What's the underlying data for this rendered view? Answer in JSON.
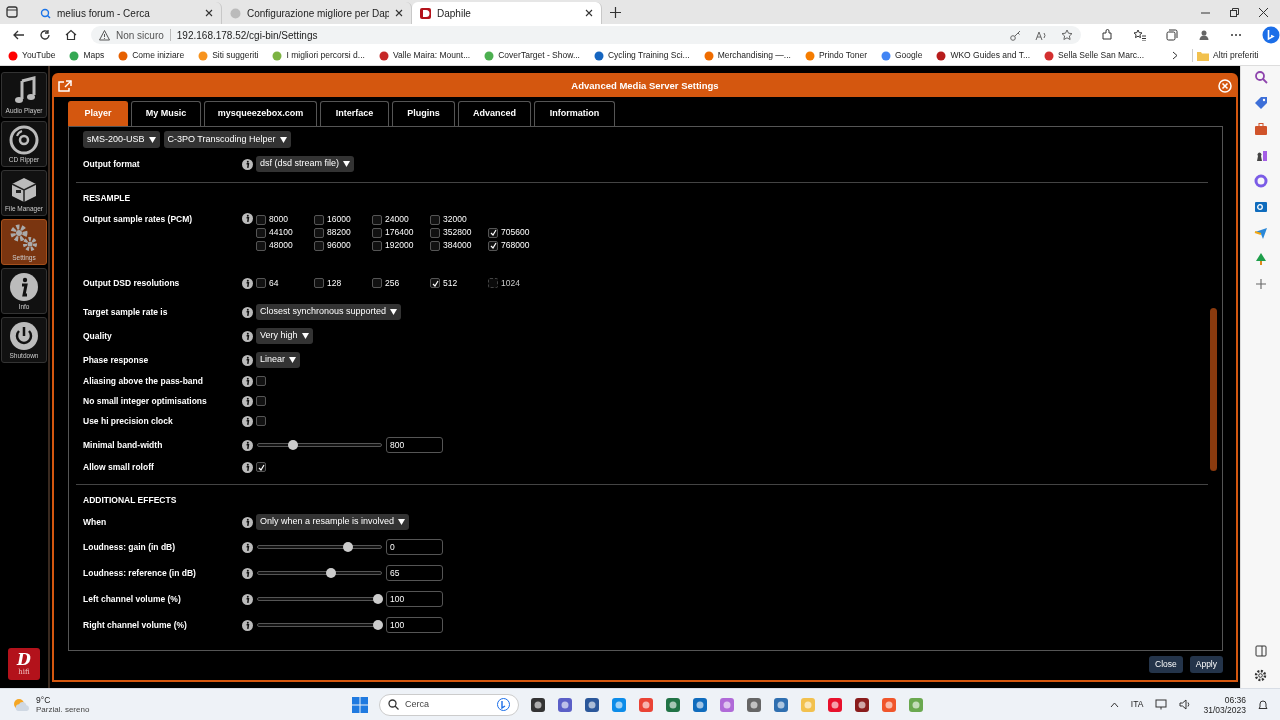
{
  "browser": {
    "tabs": [
      {
        "title": "melius forum - Cerca",
        "kind": "search",
        "selected": false
      },
      {
        "title": "Configurazione migliore per Dap",
        "kind": "page",
        "selected": false
      },
      {
        "title": "Daphile",
        "kind": "site",
        "selected": true
      }
    ],
    "security": "Non sicuro",
    "url": "192.168.178.52/cgi-bin/Settings",
    "bookmarks": [
      {
        "label": "YouTube",
        "color": "#ff0000"
      },
      {
        "label": "Maps",
        "color": "#34a853"
      },
      {
        "label": "Come iniziare",
        "color": "#e66000"
      },
      {
        "label": "Siti suggeriti",
        "color": "#f7931e"
      },
      {
        "label": "I migliori percorsi d...",
        "color": "#7cb342"
      },
      {
        "label": "Valle Maira: Mount...",
        "color": "#c62828"
      },
      {
        "label": "CoverTarget - Show...",
        "color": "#4caf50"
      },
      {
        "label": "Cycling Training Sci...",
        "color": "#1565c0"
      },
      {
        "label": "Merchandising —...",
        "color": "#ef6c00"
      },
      {
        "label": "Prindo Toner",
        "color": "#f57c00"
      },
      {
        "label": "Google",
        "color": "#4285f4"
      },
      {
        "label": "WKO Guides and T...",
        "color": "#b71c1c"
      },
      {
        "label": "Sella Selle San Marc...",
        "color": "#d32f2f"
      }
    ],
    "other_bookmarks": "Altri preferiti"
  },
  "sidebar": {
    "items": [
      {
        "label": "Audio Player",
        "kind": "music",
        "selected": false
      },
      {
        "label": "CD Ripper",
        "kind": "disc",
        "selected": false
      },
      {
        "label": "File Manager",
        "kind": "box",
        "selected": false
      },
      {
        "label": "Settings",
        "kind": "gears",
        "selected": true
      },
      {
        "label": "Info",
        "kind": "info",
        "selected": false
      },
      {
        "label": "Shutdown",
        "kind": "power",
        "selected": false
      }
    ],
    "logo": {
      "letter": "D",
      "caption": "hifi"
    }
  },
  "dialog": {
    "title": "Advanced Media Server Settings",
    "tabs": [
      {
        "label": "Player",
        "selected": true
      },
      {
        "label": "My Music",
        "selected": false
      },
      {
        "label": "mysqueezebox.com",
        "selected": false
      },
      {
        "label": "Interface",
        "selected": false
      },
      {
        "label": "Plugins",
        "selected": false
      },
      {
        "label": "Advanced",
        "selected": false
      },
      {
        "label": "Information",
        "selected": false
      }
    ],
    "selectors": [
      "sMS-200-USB",
      "C-3PO Transcoding Helper"
    ],
    "sections": [
      {
        "rows": [
          {
            "kind": "select",
            "label": "Output format",
            "value": "dsf (dsd stream file)"
          }
        ]
      },
      {
        "heading": "RESAMPLE",
        "rows": [
          {
            "kind": "checkgrid",
            "label": "Output sample rates (PCM)",
            "option_rows": [
              [
                {
                  "label": "8000",
                  "checked": false
                },
                {
                  "label": "16000",
                  "checked": false
                },
                {
                  "label": "24000",
                  "checked": false
                },
                {
                  "label": "32000",
                  "checked": false
                }
              ],
              [
                {
                  "label": "44100",
                  "checked": false
                },
                {
                  "label": "88200",
                  "checked": false
                },
                {
                  "label": "176400",
                  "checked": false
                },
                {
                  "label": "352800",
                  "checked": false
                },
                {
                  "label": "705600",
                  "checked": true
                }
              ],
              [
                {
                  "label": "48000",
                  "checked": false
                },
                {
                  "label": "96000",
                  "checked": false
                },
                {
                  "label": "192000",
                  "checked": false
                },
                {
                  "label": "384000",
                  "checked": false
                },
                {
                  "label": "768000",
                  "checked": true
                }
              ]
            ]
          },
          {
            "kind": "checkrow",
            "label": "Output DSD resolutions",
            "options": [
              {
                "label": "64",
                "checked": false,
                "disabled": false
              },
              {
                "label": "128",
                "checked": false,
                "disabled": false
              },
              {
                "label": "256",
                "checked": false,
                "disabled": false
              },
              {
                "label": "512",
                "checked": true,
                "disabled": false
              },
              {
                "label": "1024",
                "checked": false,
                "disabled": true
              }
            ]
          },
          {
            "kind": "select",
            "label": "Target sample rate is",
            "value": "Closest synchronous supported"
          },
          {
            "kind": "select",
            "label": "Quality",
            "value": "Very high"
          },
          {
            "kind": "select",
            "label": "Phase response",
            "value": "Linear"
          },
          {
            "kind": "checkbox",
            "label": "Aliasing above the pass-band",
            "checked": false
          },
          {
            "kind": "checkbox",
            "label": "No small integer optimisations",
            "checked": false
          },
          {
            "kind": "checkbox",
            "label": "Use hi precision clock",
            "checked": false
          },
          {
            "kind": "slider",
            "label": "Minimal band-width",
            "level": 0.26,
            "value": "800"
          },
          {
            "kind": "checkbox",
            "label": "Allow small roloff",
            "checked": true
          }
        ]
      },
      {
        "heading": "ADDITIONAL EFFECTS",
        "rows": [
          {
            "kind": "select",
            "label": "When",
            "value": "Only when a resample is involved"
          },
          {
            "kind": "slider",
            "label": "Loudness: gain (in dB)",
            "level": 0.74,
            "value": "0"
          },
          {
            "kind": "slider",
            "label": "Loudness: reference (in dB)",
            "level": 0.59,
            "value": "65"
          },
          {
            "kind": "slider",
            "label": "Left channel volume (%)",
            "level": 1,
            "value": "100"
          },
          {
            "kind": "slider",
            "label": "Right channel volume (%)",
            "level": 1,
            "value": "100"
          }
        ]
      }
    ],
    "buttons": [
      "Close",
      "Apply"
    ]
  },
  "taskbar": {
    "weather": {
      "temperature": "9°C",
      "condition": "Parzial. sereno"
    },
    "search": {
      "placeholder": "Cerca"
    },
    "language": "ITA",
    "time": "06:36",
    "date": "31/03/2023"
  }
}
